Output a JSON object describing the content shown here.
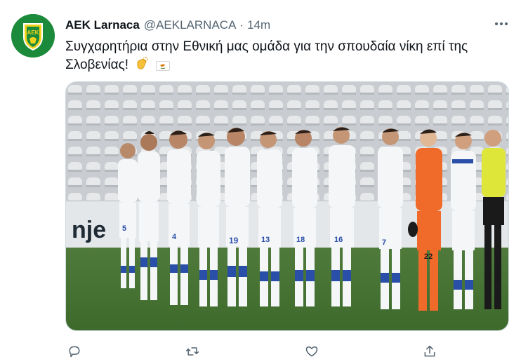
{
  "tweet": {
    "display_name": "AEK Larnaca",
    "handle": "@AEKLARNACA",
    "separator": "·",
    "time": "14m",
    "text": "Συγχαρητήρια στην Εθνική μας ομάδα για την σπουδαία νίκη επί της Σλοβενίας!",
    "emojis": [
      "clapping-hands-emoji",
      "cyprus-flag-emoji"
    ],
    "avatar_logo_text": "ΑΕΚ",
    "media": {
      "type": "photo",
      "banner_text": "nje",
      "player_numbers": [
        "5",
        "4",
        "19",
        "13",
        "18",
        "16",
        "7",
        "22"
      ]
    }
  },
  "actions": [
    {
      "name": "reply",
      "icon": "reply-icon"
    },
    {
      "name": "retweet",
      "icon": "retweet-icon"
    },
    {
      "name": "like",
      "icon": "heart-icon"
    },
    {
      "name": "share",
      "icon": "share-icon"
    }
  ],
  "colors": {
    "text_primary": "#0f1419",
    "text_secondary": "#536471",
    "avatar_bg": "#1b8a3a",
    "avatar_accent": "#f2d31b"
  }
}
